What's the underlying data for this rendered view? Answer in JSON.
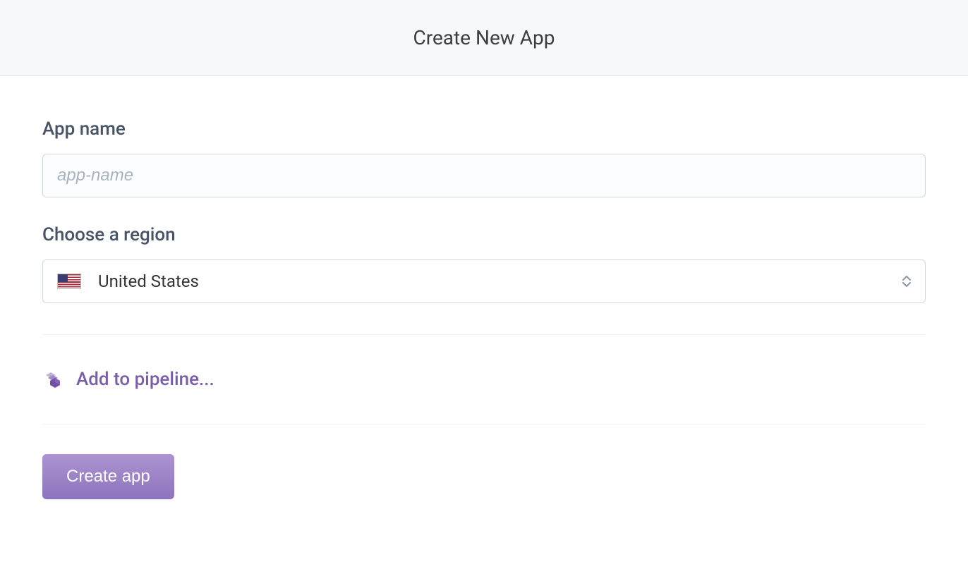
{
  "header": {
    "title": "Create New App"
  },
  "form": {
    "app_name": {
      "label": "App name",
      "placeholder": "app-name",
      "value": ""
    },
    "region": {
      "label": "Choose a region",
      "selected": "United States",
      "flag": "us"
    },
    "pipeline": {
      "label": "Add to pipeline..."
    },
    "submit": {
      "label": "Create app"
    }
  },
  "colors": {
    "accent_purple": "#7a5ea8",
    "button_gradient_top": "#ab94d0",
    "button_gradient_bottom": "#8e74bd",
    "label_text": "#475366",
    "header_bg": "#f7f8fb"
  }
}
